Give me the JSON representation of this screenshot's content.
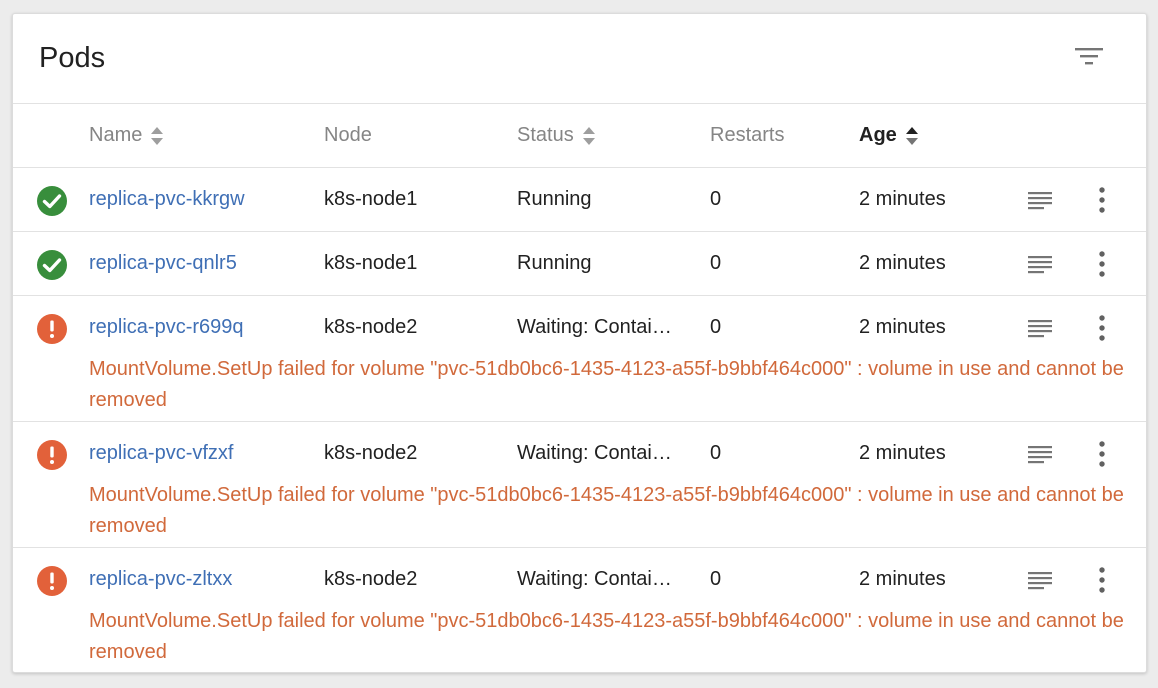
{
  "card": {
    "title": "Pods"
  },
  "columns": {
    "name": "Name",
    "node": "Node",
    "status": "Status",
    "restarts": "Restarts",
    "age": "Age"
  },
  "rows": [
    {
      "name": "replica-pvc-kkrgw",
      "node": "k8s-node1",
      "status": "Running",
      "restarts": "0",
      "age": "2 minutes",
      "state": "ok",
      "message": ""
    },
    {
      "name": "replica-pvc-qnlr5",
      "node": "k8s-node1",
      "status": "Running",
      "restarts": "0",
      "age": "2 minutes",
      "state": "ok",
      "message": ""
    },
    {
      "name": "replica-pvc-r699q",
      "node": "k8s-node2",
      "status": "Waiting: Contai…",
      "restarts": "0",
      "age": "2 minutes",
      "state": "error",
      "message": "MountVolume.SetUp failed for volume \"pvc-51db0bc6-1435-4123-a55f-b9bbf464c000\" : volume in use and cannot be removed"
    },
    {
      "name": "replica-pvc-vfzxf",
      "node": "k8s-node2",
      "status": "Waiting: Contai…",
      "restarts": "0",
      "age": "2 minutes",
      "state": "error",
      "message": "MountVolume.SetUp failed for volume \"pvc-51db0bc6-1435-4123-a55f-b9bbf464c000\" : volume in use and cannot be removed"
    },
    {
      "name": "replica-pvc-zltxx",
      "node": "k8s-node2",
      "status": "Waiting: Contai…",
      "restarts": "0",
      "age": "2 minutes",
      "state": "error",
      "message": "MountVolume.SetUp failed for volume \"pvc-51db0bc6-1435-4123-a55f-b9bbf464c000\" : volume in use and cannot be removed"
    }
  ],
  "colors": {
    "success": "#388e3c",
    "error": "#e2613a",
    "link": "#3f6fb5",
    "error_text": "#d1693b"
  },
  "icons": {
    "filter": "filter-list-icon",
    "sort": "sort-icon",
    "success": "check-circle-icon",
    "error": "error-circle-icon",
    "logs": "logs-icon",
    "more": "more-vert-icon"
  }
}
